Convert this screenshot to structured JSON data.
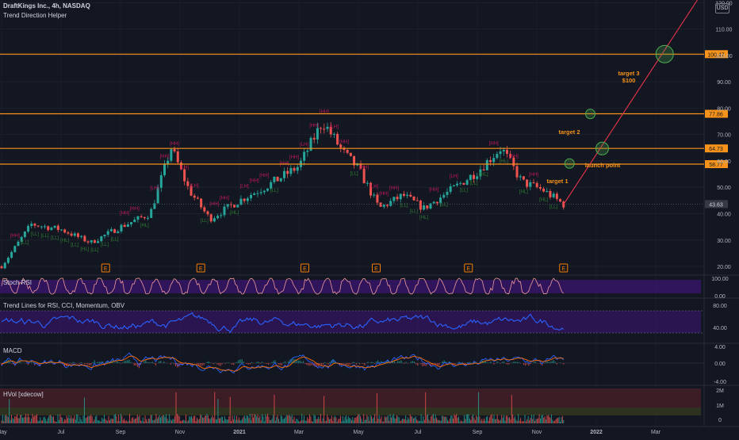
{
  "header": {
    "symbol": "DraftKings Inc., 4h, NASDAQ",
    "indicator": "Trend Direction Helper",
    "currency": "USD"
  },
  "colors": {
    "background": "#131722",
    "bull": "#26a69a",
    "bear": "#ef5350",
    "level_line": "#f7931a",
    "trend_line": "#e8334a",
    "target_circle": "#4caf50",
    "rsi_line": "#ef9a9a",
    "rsi_fill": "#4a148c",
    "trendlines_line": "#2962ff",
    "macd_line": "#2962ff",
    "signal_line": "#ff6d00",
    "volume_up": "#26a69a",
    "volume_down": "#ef5350"
  },
  "price_axis": {
    "ticks": [
      "120.00",
      "110.00",
      "100.00",
      "90.00",
      "80.00",
      "70.00",
      "60.00",
      "50.00",
      "40.00",
      "30.00",
      "20.00"
    ],
    "tick_values": [
      120,
      110,
      100,
      90,
      80,
      70,
      60,
      50,
      40,
      30,
      20
    ],
    "range": [
      17,
      121
    ]
  },
  "time_axis": {
    "labels": [
      "May",
      "Jul",
      "Sep",
      "Nov",
      "2021",
      "Mar",
      "May",
      "Jul",
      "Sep",
      "Nov",
      "2022",
      "Mar"
    ],
    "months": [
      0,
      2,
      4,
      6,
      8,
      10,
      12,
      14,
      16,
      18,
      20,
      22
    ]
  },
  "chart_data": {
    "type": "line",
    "price_series": {
      "name": "",
      "points": [
        [
          0,
          20
        ],
        [
          1,
          36
        ],
        [
          2,
          34
        ],
        [
          3,
          29
        ],
        [
          4,
          35
        ],
        [
          5,
          40
        ],
        [
          5.7,
          65
        ],
        [
          6.3,
          49
        ],
        [
          7,
          38
        ],
        [
          8,
          45
        ],
        [
          9,
          51
        ],
        [
          10,
          58
        ],
        [
          10.8,
          75
        ],
        [
          11.5,
          63
        ],
        [
          12,
          57
        ],
        [
          12.7,
          42
        ],
        [
          13.5,
          47
        ],
        [
          14.2,
          42
        ],
        [
          15,
          48
        ],
        [
          16,
          56
        ],
        [
          16.8,
          65
        ],
        [
          17.5,
          52
        ],
        [
          18.2,
          49
        ],
        [
          18.9,
          43.5
        ]
      ]
    },
    "levels": [
      {
        "value": 100.47,
        "label": "100.47"
      },
      {
        "value": 77.86,
        "label": "77.86"
      },
      {
        "value": 64.73,
        "label": "64.73"
      },
      {
        "value": 58.77,
        "label": "58.77"
      }
    ],
    "current_price": {
      "value": 43.63,
      "label": "43.63"
    },
    "trend_line": [
      [
        18.9,
        43.5
      ],
      [
        23.4,
        121
      ]
    ],
    "targets": [
      {
        "label": "target 1",
        "x": 19.1,
        "y": 59
      },
      {
        "label": "target 2",
        "x": 19.8,
        "y": 77.8
      },
      {
        "label": "launch point",
        "x": 20.2,
        "y": 64.7
      },
      {
        "label": "target 3\n$100",
        "x": 22.3,
        "y": 100.5
      }
    ],
    "earnings_markers": [
      3.5,
      6.7,
      10.2,
      12.6,
      15.7,
      18.9
    ],
    "swing_labels": [
      "[HH]",
      "[LH]",
      "[HL]",
      "[LL]"
    ],
    "subpanels": [
      {
        "name": "Stoch RSI",
        "ticks": [
          "100.00",
          "0.00"
        ]
      },
      {
        "name": "Trend Lines for RSI, CCI, Momentum, OBV",
        "ticks": [
          "80.00",
          "40.00"
        ]
      },
      {
        "name": "MACD",
        "ticks": [
          "4.00",
          "0.00",
          "-4.00"
        ]
      },
      {
        "name": "HVol [xdecow]",
        "ticks": [
          "2M",
          "1M",
          "0"
        ]
      }
    ]
  }
}
